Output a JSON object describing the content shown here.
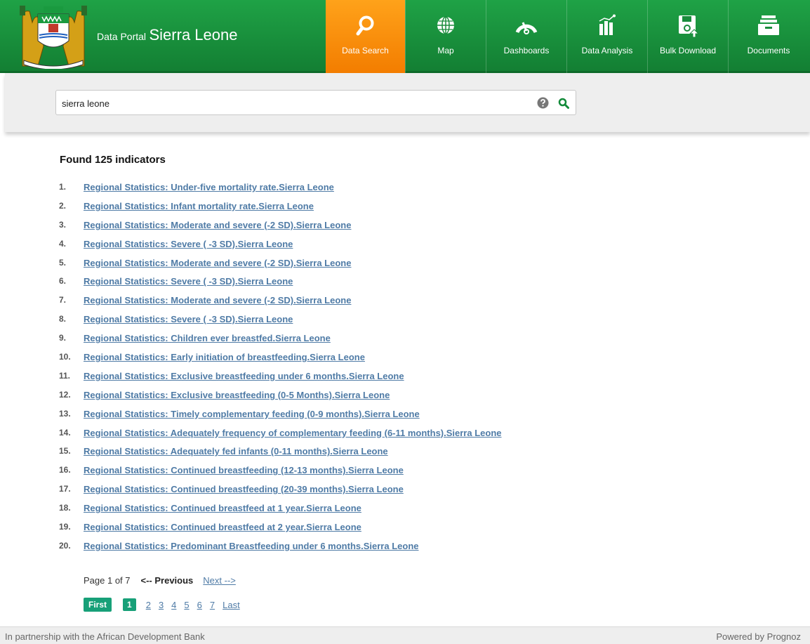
{
  "header": {
    "portal_prefix": "Data Portal",
    "portal_name": "Sierra Leone",
    "nav": [
      {
        "label": "Data Search",
        "icon": "search-icon",
        "active": true
      },
      {
        "label": "Map",
        "icon": "globe-icon",
        "active": false
      },
      {
        "label": "Dashboards",
        "icon": "gauge-icon",
        "active": false
      },
      {
        "label": "Data Analysis",
        "icon": "bar-chart-icon",
        "active": false
      },
      {
        "label": "Bulk Download",
        "icon": "floppy-upload-icon",
        "active": false
      },
      {
        "label": "Documents",
        "icon": "documents-tray-icon",
        "active": false
      }
    ],
    "colors": {
      "green": "#1a9a3f",
      "active_orange": "#f7931e"
    }
  },
  "search": {
    "value": "sierra leone",
    "help_icon": "help-icon",
    "submit_icon": "search-icon"
  },
  "results": {
    "summary": "Found  125 indicators",
    "items": [
      {
        "num": "1.",
        "label": "Regional Statistics: Under-five mortality rate.Sierra Leone"
      },
      {
        "num": "2.",
        "label": "Regional Statistics: Infant mortality rate.Sierra Leone"
      },
      {
        "num": "3.",
        "label": "Regional Statistics: Moderate and severe (-2 SD).Sierra Leone"
      },
      {
        "num": "4.",
        "label": "Regional Statistics: Severe ( -3 SD).Sierra Leone"
      },
      {
        "num": "5.",
        "label": "Regional Statistics: Moderate and severe (-2 SD).Sierra Leone"
      },
      {
        "num": "6.",
        "label": "Regional Statistics: Severe ( -3 SD).Sierra Leone"
      },
      {
        "num": "7.",
        "label": "Regional Statistics: Moderate and severe (-2 SD).Sierra Leone"
      },
      {
        "num": "8.",
        "label": "Regional Statistics: Severe ( -3 SD).Sierra Leone"
      },
      {
        "num": "9.",
        "label": "Regional Statistics: Children ever breastfed.Sierra Leone"
      },
      {
        "num": "10.",
        "label": "Regional Statistics: Early initiation of breastfeeding.Sierra Leone"
      },
      {
        "num": "11.",
        "label": "Regional Statistics: Exclusive breastfeeding under 6 months.Sierra Leone"
      },
      {
        "num": "12.",
        "label": "Regional Statistics: Exclusive breastfeeding (0-5 Months).Sierra Leone"
      },
      {
        "num": "13.",
        "label": "Regional Statistics: Timely complementary feeding (0-9 months).Sierra Leone"
      },
      {
        "num": "14.",
        "label": "Regional Statistics: Adequately frequency of complementary feeding (6-11 months).Sierra Leone"
      },
      {
        "num": "15.",
        "label": "Regional Statistics: Adequately fed infants (0-11 months).Sierra Leone"
      },
      {
        "num": "16.",
        "label": "Regional Statistics: Continued breastfeeding (12-13 months).Sierra Leone"
      },
      {
        "num": "17.",
        "label": "Regional Statistics: Continued breastfeeding (20-39 months).Sierra Leone"
      },
      {
        "num": "18.",
        "label": "Regional Statistics: Continued breastfeed at 1 year.Sierra Leone"
      },
      {
        "num": "19.",
        "label": "Regional Statistics: Continued breastfeed at 2 year.Sierra Leone"
      },
      {
        "num": "20.",
        "label": "Regional Statistics: Predominant Breastfeeding under 6 months.Sierra Leone"
      }
    ]
  },
  "pagination": {
    "page_of": "Page 1 of 7",
    "previous": "<-- Previous",
    "next": "Next -->",
    "first": "First",
    "pages": [
      "1",
      "2",
      "3",
      "4",
      "5",
      "6",
      "7"
    ],
    "current": "1",
    "last": "Last"
  },
  "footer": {
    "left": "In partnership with the African Development Bank",
    "right": "Powered by Prognoz"
  }
}
